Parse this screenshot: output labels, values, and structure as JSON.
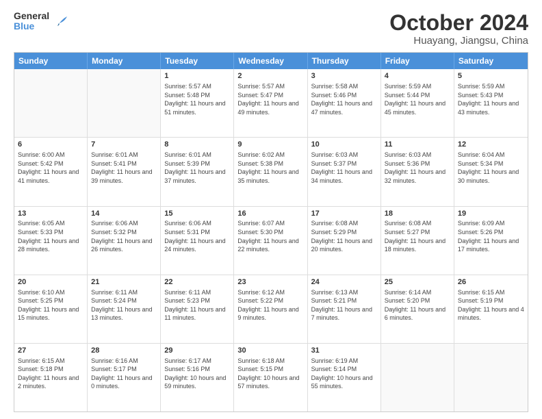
{
  "header": {
    "logo_line1": "General",
    "logo_line2": "Blue",
    "month": "October 2024",
    "location": "Huayang, Jiangsu, China"
  },
  "weekdays": [
    "Sunday",
    "Monday",
    "Tuesday",
    "Wednesday",
    "Thursday",
    "Friday",
    "Saturday"
  ],
  "rows": [
    [
      {
        "day": "",
        "info": ""
      },
      {
        "day": "",
        "info": ""
      },
      {
        "day": "1",
        "info": "Sunrise: 5:57 AM\nSunset: 5:48 PM\nDaylight: 11 hours and 51 minutes."
      },
      {
        "day": "2",
        "info": "Sunrise: 5:57 AM\nSunset: 5:47 PM\nDaylight: 11 hours and 49 minutes."
      },
      {
        "day": "3",
        "info": "Sunrise: 5:58 AM\nSunset: 5:46 PM\nDaylight: 11 hours and 47 minutes."
      },
      {
        "day": "4",
        "info": "Sunrise: 5:59 AM\nSunset: 5:44 PM\nDaylight: 11 hours and 45 minutes."
      },
      {
        "day": "5",
        "info": "Sunrise: 5:59 AM\nSunset: 5:43 PM\nDaylight: 11 hours and 43 minutes."
      }
    ],
    [
      {
        "day": "6",
        "info": "Sunrise: 6:00 AM\nSunset: 5:42 PM\nDaylight: 11 hours and 41 minutes."
      },
      {
        "day": "7",
        "info": "Sunrise: 6:01 AM\nSunset: 5:41 PM\nDaylight: 11 hours and 39 minutes."
      },
      {
        "day": "8",
        "info": "Sunrise: 6:01 AM\nSunset: 5:39 PM\nDaylight: 11 hours and 37 minutes."
      },
      {
        "day": "9",
        "info": "Sunrise: 6:02 AM\nSunset: 5:38 PM\nDaylight: 11 hours and 35 minutes."
      },
      {
        "day": "10",
        "info": "Sunrise: 6:03 AM\nSunset: 5:37 PM\nDaylight: 11 hours and 34 minutes."
      },
      {
        "day": "11",
        "info": "Sunrise: 6:03 AM\nSunset: 5:36 PM\nDaylight: 11 hours and 32 minutes."
      },
      {
        "day": "12",
        "info": "Sunrise: 6:04 AM\nSunset: 5:34 PM\nDaylight: 11 hours and 30 minutes."
      }
    ],
    [
      {
        "day": "13",
        "info": "Sunrise: 6:05 AM\nSunset: 5:33 PM\nDaylight: 11 hours and 28 minutes."
      },
      {
        "day": "14",
        "info": "Sunrise: 6:06 AM\nSunset: 5:32 PM\nDaylight: 11 hours and 26 minutes."
      },
      {
        "day": "15",
        "info": "Sunrise: 6:06 AM\nSunset: 5:31 PM\nDaylight: 11 hours and 24 minutes."
      },
      {
        "day": "16",
        "info": "Sunrise: 6:07 AM\nSunset: 5:30 PM\nDaylight: 11 hours and 22 minutes."
      },
      {
        "day": "17",
        "info": "Sunrise: 6:08 AM\nSunset: 5:29 PM\nDaylight: 11 hours and 20 minutes."
      },
      {
        "day": "18",
        "info": "Sunrise: 6:08 AM\nSunset: 5:27 PM\nDaylight: 11 hours and 18 minutes."
      },
      {
        "day": "19",
        "info": "Sunrise: 6:09 AM\nSunset: 5:26 PM\nDaylight: 11 hours and 17 minutes."
      }
    ],
    [
      {
        "day": "20",
        "info": "Sunrise: 6:10 AM\nSunset: 5:25 PM\nDaylight: 11 hours and 15 minutes."
      },
      {
        "day": "21",
        "info": "Sunrise: 6:11 AM\nSunset: 5:24 PM\nDaylight: 11 hours and 13 minutes."
      },
      {
        "day": "22",
        "info": "Sunrise: 6:11 AM\nSunset: 5:23 PM\nDaylight: 11 hours and 11 minutes."
      },
      {
        "day": "23",
        "info": "Sunrise: 6:12 AM\nSunset: 5:22 PM\nDaylight: 11 hours and 9 minutes."
      },
      {
        "day": "24",
        "info": "Sunrise: 6:13 AM\nSunset: 5:21 PM\nDaylight: 11 hours and 7 minutes."
      },
      {
        "day": "25",
        "info": "Sunrise: 6:14 AM\nSunset: 5:20 PM\nDaylight: 11 hours and 6 minutes."
      },
      {
        "day": "26",
        "info": "Sunrise: 6:15 AM\nSunset: 5:19 PM\nDaylight: 11 hours and 4 minutes."
      }
    ],
    [
      {
        "day": "27",
        "info": "Sunrise: 6:15 AM\nSunset: 5:18 PM\nDaylight: 11 hours and 2 minutes."
      },
      {
        "day": "28",
        "info": "Sunrise: 6:16 AM\nSunset: 5:17 PM\nDaylight: 11 hours and 0 minutes."
      },
      {
        "day": "29",
        "info": "Sunrise: 6:17 AM\nSunset: 5:16 PM\nDaylight: 10 hours and 59 minutes."
      },
      {
        "day": "30",
        "info": "Sunrise: 6:18 AM\nSunset: 5:15 PM\nDaylight: 10 hours and 57 minutes."
      },
      {
        "day": "31",
        "info": "Sunrise: 6:19 AM\nSunset: 5:14 PM\nDaylight: 10 hours and 55 minutes."
      },
      {
        "day": "",
        "info": ""
      },
      {
        "day": "",
        "info": ""
      }
    ]
  ]
}
